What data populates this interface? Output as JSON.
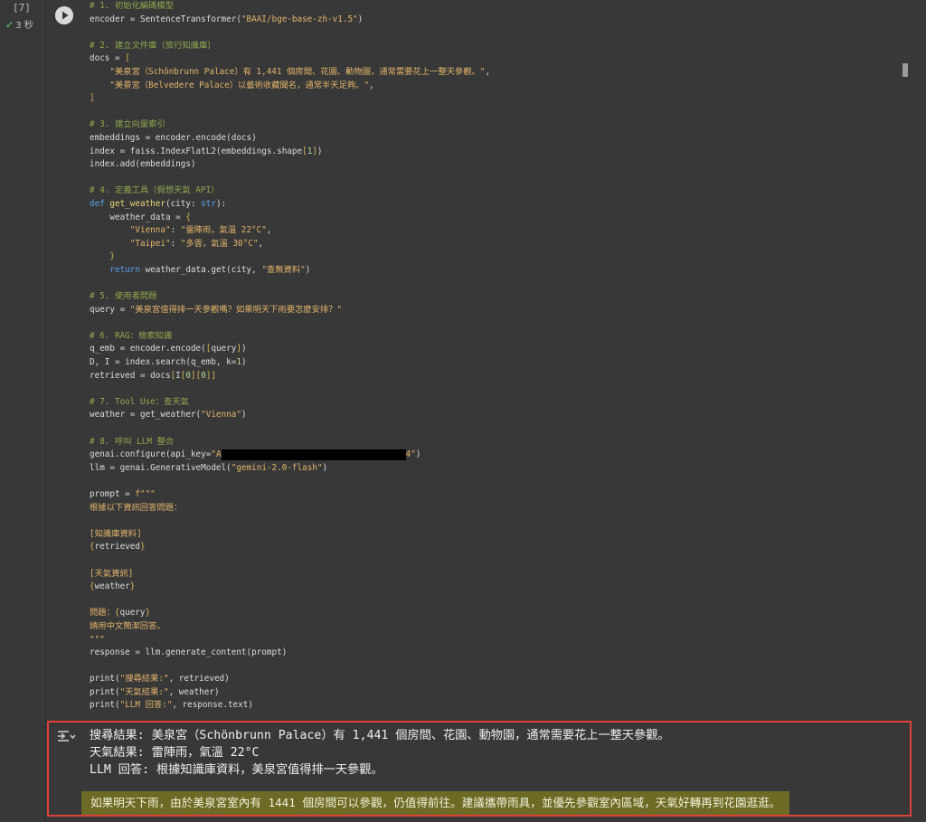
{
  "cell": {
    "execution_count": "[7]",
    "status_icon": "check-icon",
    "duration": "3 秒",
    "run_icon": "play-icon"
  },
  "code_lines": [
    [
      {
        "t": "# 1. 初始化編碼模型",
        "c": "comment"
      }
    ],
    [
      {
        "t": "encoder = SentenceTransformer(",
        "c": "code"
      },
      {
        "t": "\"BAAI/bge-base-zh-v1.5\"",
        "c": "string"
      },
      {
        "t": ")",
        "c": "code"
      }
    ],
    [],
    [
      {
        "t": "# 2. 建立文件庫（旅行知識庫）",
        "c": "comment"
      }
    ],
    [
      {
        "t": "docs = ",
        "c": "code"
      },
      {
        "t": "[",
        "c": "bracket"
      }
    ],
    [
      {
        "t": "    ",
        "c": "code"
      },
      {
        "t": "\"美泉宮（Schönbrunn Palace）有 1,441 個房間、花園、動物園，通常需要花上一整天參觀。\"",
        "c": "string"
      },
      {
        "t": ",",
        "c": "code"
      }
    ],
    [
      {
        "t": "    ",
        "c": "code"
      },
      {
        "t": "\"美景宮（Belvedere Palace）以藝術收藏聞名，通常半天足夠。\"",
        "c": "string"
      },
      {
        "t": ",",
        "c": "code"
      }
    ],
    [
      {
        "t": "]",
        "c": "bracket"
      }
    ],
    [],
    [
      {
        "t": "# 3. 建立向量索引",
        "c": "comment"
      }
    ],
    [
      {
        "t": "embeddings = encoder.encode(docs)",
        "c": "code"
      }
    ],
    [
      {
        "t": "index = faiss.IndexFlatL2(embeddings.shape",
        "c": "code"
      },
      {
        "t": "[",
        "c": "bracket"
      },
      {
        "t": "1",
        "c": "num"
      },
      {
        "t": "]",
        "c": "bracket"
      },
      {
        "t": ")",
        "c": "code"
      }
    ],
    [
      {
        "t": "index.add(embeddings)",
        "c": "code"
      }
    ],
    [],
    [
      {
        "t": "# 4. 定義工具（假想天氣 API）",
        "c": "comment"
      }
    ],
    [
      {
        "t": "def ",
        "c": "keyword"
      },
      {
        "t": "get_weather",
        "c": "fn"
      },
      {
        "t": "(city: ",
        "c": "code"
      },
      {
        "t": "str",
        "c": "keyword"
      },
      {
        "t": "):",
        "c": "code"
      }
    ],
    [
      {
        "t": "    weather_data = ",
        "c": "code"
      },
      {
        "t": "{",
        "c": "bracket"
      }
    ],
    [
      {
        "t": "        ",
        "c": "code"
      },
      {
        "t": "\"Vienna\"",
        "c": "string"
      },
      {
        "t": ": ",
        "c": "code"
      },
      {
        "t": "\"雷陣雨，氣溫 22°C\"",
        "c": "string"
      },
      {
        "t": ",",
        "c": "code"
      }
    ],
    [
      {
        "t": "        ",
        "c": "code"
      },
      {
        "t": "\"Taipei\"",
        "c": "string"
      },
      {
        "t": ": ",
        "c": "code"
      },
      {
        "t": "\"多雲，氣溫 30°C\"",
        "c": "string"
      },
      {
        "t": ",",
        "c": "code"
      }
    ],
    [
      {
        "t": "    ",
        "c": "code"
      },
      {
        "t": "}",
        "c": "bracket"
      }
    ],
    [
      {
        "t": "    ",
        "c": "code"
      },
      {
        "t": "return",
        "c": "keyword"
      },
      {
        "t": " weather_data.get(city, ",
        "c": "code"
      },
      {
        "t": "\"查無資料\"",
        "c": "string"
      },
      {
        "t": ")",
        "c": "code"
      }
    ],
    [],
    [
      {
        "t": "# 5. 使用者問題",
        "c": "comment"
      }
    ],
    [
      {
        "t": "query = ",
        "c": "code"
      },
      {
        "t": "\"美泉宮值得排一天參觀嗎？如果明天下雨要怎麼安排？\"",
        "c": "string"
      }
    ],
    [],
    [
      {
        "t": "# 6. RAG：檢索知識",
        "c": "comment"
      }
    ],
    [
      {
        "t": "q_emb = encoder.encode(",
        "c": "code"
      },
      {
        "t": "[",
        "c": "bracket"
      },
      {
        "t": "query",
        "c": "code"
      },
      {
        "t": "]",
        "c": "bracket"
      },
      {
        "t": ")",
        "c": "code"
      }
    ],
    [
      {
        "t": "D, I = index.search(q_emb, k=",
        "c": "code"
      },
      {
        "t": "1",
        "c": "num"
      },
      {
        "t": ")",
        "c": "code"
      }
    ],
    [
      {
        "t": "retrieved = docs",
        "c": "code"
      },
      {
        "t": "[",
        "c": "bracket"
      },
      {
        "t": "I",
        "c": "code"
      },
      {
        "t": "[",
        "c": "bracket"
      },
      {
        "t": "0",
        "c": "num"
      },
      {
        "t": "]",
        "c": "bracket"
      },
      {
        "t": "[",
        "c": "bracket"
      },
      {
        "t": "0",
        "c": "num"
      },
      {
        "t": "]]",
        "c": "bracket"
      }
    ],
    [],
    [
      {
        "t": "# 7. Tool Use：查天氣",
        "c": "comment"
      }
    ],
    [
      {
        "t": "weather = get_weather(",
        "c": "code"
      },
      {
        "t": "\"Vienna\"",
        "c": "string"
      },
      {
        "t": ")",
        "c": "code"
      }
    ],
    [],
    [
      {
        "t": "# 8. 呼叫 LLM 整合",
        "c": "comment"
      }
    ],
    [
      {
        "t": "genai.configure(api_key=",
        "c": "code"
      },
      {
        "t": "\"A",
        "c": "string"
      },
      {
        "t": "",
        "c": "redact"
      },
      {
        "t": "4\"",
        "c": "string"
      },
      {
        "t": ")",
        "c": "code"
      }
    ],
    [
      {
        "t": "llm = genai.GenerativeModel(",
        "c": "code"
      },
      {
        "t": "\"gemini-2.0-flash\"",
        "c": "string"
      },
      {
        "t": ")",
        "c": "code"
      }
    ],
    [],
    [
      {
        "t": "prompt = ",
        "c": "code"
      },
      {
        "t": "f\"\"\"",
        "c": "string"
      }
    ],
    [
      {
        "t": "根據以下資訊回答問題：",
        "c": "string"
      }
    ],
    [],
    [
      {
        "t": "[知識庫資料]",
        "c": "string"
      }
    ],
    [
      {
        "t": "{",
        "c": "bracket"
      },
      {
        "t": "retrieved",
        "c": "code"
      },
      {
        "t": "}",
        "c": "bracket"
      }
    ],
    [],
    [
      {
        "t": "[天氣資訊]",
        "c": "string"
      }
    ],
    [
      {
        "t": "{",
        "c": "bracket"
      },
      {
        "t": "weather",
        "c": "code"
      },
      {
        "t": "}",
        "c": "bracket"
      }
    ],
    [],
    [
      {
        "t": "問題：",
        "c": "string"
      },
      {
        "t": "{",
        "c": "bracket"
      },
      {
        "t": "query",
        "c": "code"
      },
      {
        "t": "}",
        "c": "bracket"
      }
    ],
    [
      {
        "t": "請用中文簡潔回答。",
        "c": "string"
      }
    ],
    [
      {
        "t": "\"\"\"",
        "c": "string"
      }
    ],
    [
      {
        "t": "response = llm.generate_content(prompt)",
        "c": "code"
      }
    ],
    [],
    [
      {
        "t": "print(",
        "c": "code"
      },
      {
        "t": "\"搜尋結果:\"",
        "c": "string"
      },
      {
        "t": ", retrieved)",
        "c": "code"
      }
    ],
    [
      {
        "t": "print(",
        "c": "code"
      },
      {
        "t": "\"天氣結果:\"",
        "c": "string"
      },
      {
        "t": ", weather)",
        "c": "code"
      }
    ],
    [
      {
        "t": "print(",
        "c": "code"
      },
      {
        "t": "\"LLM 回答:\"",
        "c": "string"
      },
      {
        "t": ", response.text)",
        "c": "code"
      }
    ]
  ],
  "output": {
    "icon": "output-toggle-icon",
    "lines": [
      "搜尋結果: 美泉宮（Schönbrunn Palace）有 1,441 個房間、花園、動物園，通常需要花上一整天參觀。",
      "天氣結果: 雷陣雨，氣溫 22°C",
      "LLM 回答: 根據知識庫資料，美泉宮值得排一天參觀。"
    ],
    "highlight": "如果明天下雨，由於美泉宮室內有 1441 個房間可以參觀，仍值得前往。建議攜帶雨具，並優先參觀室內區域，天氣好轉再到花園逛逛。"
  },
  "colors": {
    "background": "#383838",
    "comment": "#8fa84e",
    "string": "#e2b56b",
    "keyword": "#5aa2e8",
    "output_border": "#e0403a",
    "highlight_bg": "#6d6a26"
  }
}
